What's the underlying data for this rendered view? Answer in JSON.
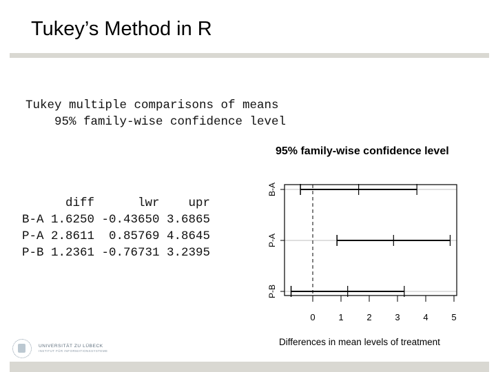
{
  "slide": {
    "title": "Tukey’s Method in R",
    "colors": {
      "rule": "#d9d8d2",
      "gridline": "#cccccc",
      "ink": "#000000"
    }
  },
  "console": {
    "header_line1": "Tukey multiple comparisons of means",
    "header_line2": "    95% family-wise confidence level",
    "columns": [
      "diff",
      "lwr",
      "upr"
    ],
    "rows": [
      {
        "name": "B-A",
        "diff": "1.6250",
        "lwr": "-0.43650",
        "upr": "3.6865"
      },
      {
        "name": "P-A",
        "diff": "2.8611",
        "lwr": "0.85769",
        "upr": "4.8645"
      },
      {
        "name": "P-B",
        "diff": "1.2361",
        "lwr": "-0.76731",
        "upr": "3.2395"
      }
    ]
  },
  "logo": {
    "name": "UNIVERSITÄT ZU LÜBECK",
    "subtitle": "INSTITUT FÜR INFORMATIONSSYSTEME"
  },
  "chart_data": {
    "type": "interval",
    "title": "95% family-wise confidence level",
    "xlabel": "Differences in mean levels of treatment",
    "ylabel": "",
    "xlim": [
      -1.0,
      5.1
    ],
    "x_ticks": [
      0,
      1,
      2,
      3,
      4,
      5
    ],
    "x_tick_labels": [
      "0",
      "1",
      "2",
      "3",
      "4",
      "5"
    ],
    "reference_line": {
      "x": 0,
      "style": "dashed"
    },
    "categories": [
      "B-A",
      "P-A",
      "P-B"
    ],
    "series": [
      {
        "name": "B-A",
        "diff": 1.625,
        "lwr": -0.4365,
        "upr": 3.6865
      },
      {
        "name": "P-A",
        "diff": 2.8611,
        "lwr": 0.85769,
        "upr": 4.8645
      },
      {
        "name": "P-B",
        "diff": 1.2361,
        "lwr": -0.76731,
        "upr": 3.2395
      }
    ],
    "grid": "horizontal gray lines at each comparison",
    "legend": "none"
  }
}
